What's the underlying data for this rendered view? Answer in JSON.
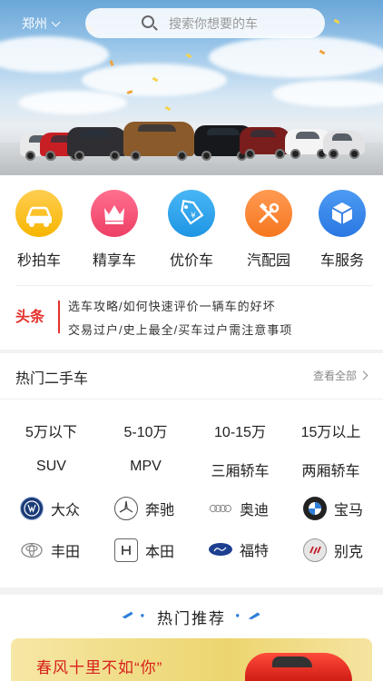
{
  "header": {
    "city": "郑州",
    "search_placeholder": "搜索你想要的车"
  },
  "categories": [
    {
      "label": "秒拍车",
      "icon": "car-icon",
      "color": "#f7b500"
    },
    {
      "label": "精享车",
      "icon": "crown-icon",
      "color": "#ee3f66"
    },
    {
      "label": "优价车",
      "icon": "tag-icon",
      "color": "#1f95e3"
    },
    {
      "label": "汽配园",
      "icon": "tools-icon",
      "color": "#f6771f"
    },
    {
      "label": "车服务",
      "icon": "box-icon",
      "color": "#2a77e3"
    }
  ],
  "headline": {
    "tag": "头条",
    "lines": [
      "选车攻略/如何快速评价一辆车的好坏",
      "交易过户/史上最全/买车过户需注意事项"
    ]
  },
  "hot_used": {
    "title": "热门二手车",
    "see_all": "查看全部",
    "price_ranges": [
      "5万以下",
      "5-10万",
      "10-15万",
      "15万以上"
    ],
    "body_types": [
      "SUV",
      "MPV",
      "三厢轿车",
      "两厢轿车"
    ],
    "brands": [
      {
        "name": "大众",
        "icon": "volkswagen-logo"
      },
      {
        "name": "奔驰",
        "icon": "mercedes-logo"
      },
      {
        "name": "奥迪",
        "icon": "audi-logo"
      },
      {
        "name": "宝马",
        "icon": "bmw-logo"
      },
      {
        "name": "丰田",
        "icon": "toyota-logo"
      },
      {
        "name": "本田",
        "icon": "honda-logo"
      },
      {
        "name": "福特",
        "icon": "ford-logo"
      },
      {
        "name": "别克",
        "icon": "buick-logo"
      }
    ]
  },
  "recommend": {
    "title": "热门推荐",
    "banner_text": "春风十里不如“你”"
  }
}
